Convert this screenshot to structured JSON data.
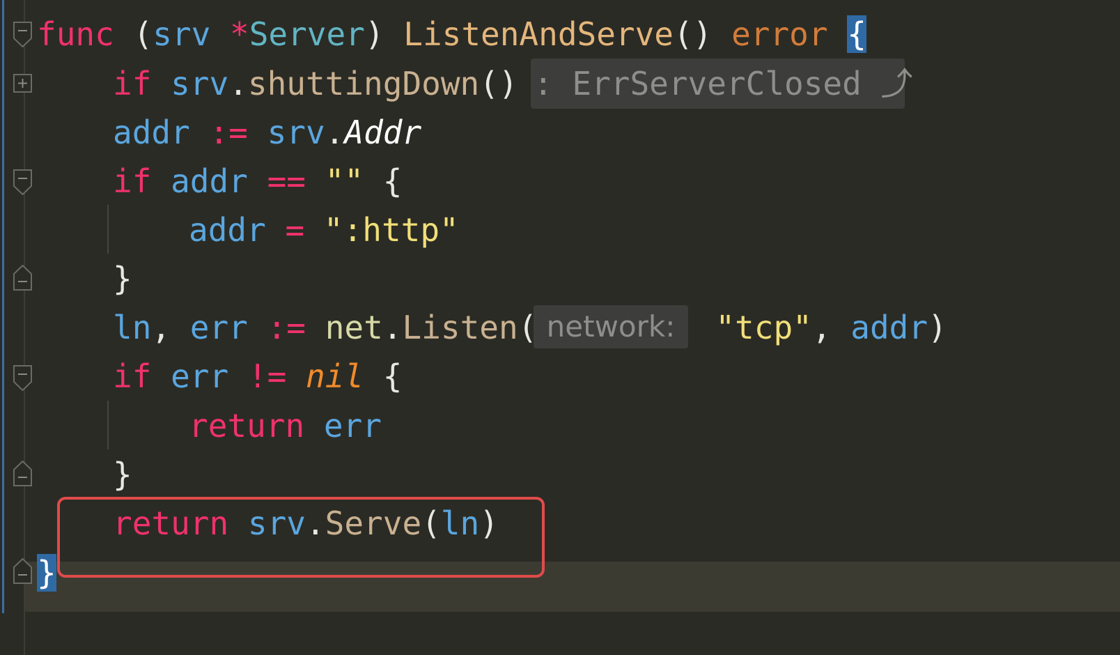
{
  "code": {
    "line1": {
      "kw": "func",
      "open": "(",
      "recv": "srv",
      "star": "*",
      "type": "Server",
      "close": ")",
      "name": "ListenAndServe",
      "parens": "()",
      "ret": "error",
      "brace": "{"
    },
    "line2": {
      "kw": "if",
      "var": "srv",
      "dot": ".",
      "call": "shuttingDown",
      "parens": "()"
    },
    "line2_hint": ": ErrServerClosed ⤴",
    "line3": {
      "var": "addr",
      "op": ":=",
      "recv": "srv",
      "dot": ".",
      "field": "Addr"
    },
    "line4": {
      "kw": "if",
      "var": "addr",
      "op": "==",
      "str": "\"\"",
      "brace": "{"
    },
    "line5": {
      "var": "addr",
      "op": "=",
      "str": "\":http\""
    },
    "line6": {
      "brace": "}"
    },
    "line7": {
      "v1": "ln",
      "comma": ",",
      "v2": "err",
      "op": ":=",
      "pkg": "net",
      "dot": ".",
      "call": "Listen",
      "open": "(",
      "str": "\"tcp\"",
      "comma2": ",",
      "arg": "addr",
      "close": ")"
    },
    "line7_hint": "network:",
    "line8": {
      "kw": "if",
      "var": "err",
      "op": "!=",
      "nil": "nil",
      "brace": "{"
    },
    "line9": {
      "kw": "return",
      "var": "err"
    },
    "line10": {
      "brace": "}"
    },
    "line11": {
      "kw": "return",
      "recv": "srv",
      "dot": ".",
      "call": "Serve",
      "open": "(",
      "arg": "ln",
      "close": ")"
    },
    "line12": {
      "brace": "}"
    }
  },
  "colors": {
    "background": "#2b2b25",
    "keyword": "#f0326c",
    "variable": "#5aa6df",
    "highlight_box": "#e04b4b",
    "brace_match": "#2f6aa4"
  },
  "gutter_icons": [
    "fold-collapse-icon",
    "fold-expand-icon",
    "fold-collapse-icon",
    "fold-end-icon",
    "fold-collapse-icon",
    "fold-end-icon",
    "fold-end-icon"
  ]
}
